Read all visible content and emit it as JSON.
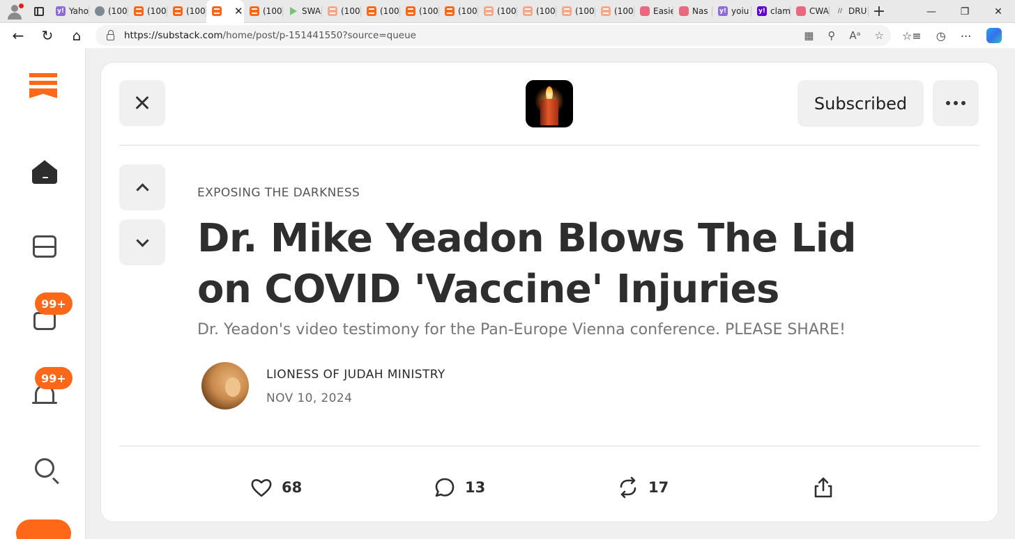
{
  "browser": {
    "tabs": [
      {
        "label": "Yaho",
        "favicon": "yahoo-icon",
        "type": "yahoo"
      },
      {
        "label": "(100",
        "favicon": "globe-icon",
        "type": "globe"
      },
      {
        "label": "(100",
        "favicon": "substack-icon",
        "type": "substack"
      },
      {
        "label": "(100",
        "favicon": "substack-icon",
        "type": "substack"
      },
      {
        "label": "",
        "favicon": "substack-icon",
        "type": "substack",
        "active": true
      },
      {
        "label": "(100",
        "favicon": "substack-icon",
        "type": "substack"
      },
      {
        "label": "SWA",
        "favicon": "play-icon",
        "type": "play"
      },
      {
        "label": "(100",
        "favicon": "substack-icon",
        "type": "substack-faded"
      },
      {
        "label": "(100",
        "favicon": "substack-icon",
        "type": "substack"
      },
      {
        "label": "(100",
        "favicon": "substack-icon",
        "type": "substack"
      },
      {
        "label": "(100",
        "favicon": "substack-icon",
        "type": "substack"
      },
      {
        "label": "(100",
        "favicon": "substack-icon",
        "type": "substack-faded"
      },
      {
        "label": "(100",
        "favicon": "substack-icon",
        "type": "substack-faded"
      },
      {
        "label": "(100",
        "favicon": "substack-icon",
        "type": "substack-faded"
      },
      {
        "label": "(100",
        "favicon": "substack-icon",
        "type": "substack-faded"
      },
      {
        "label": "Easie",
        "favicon": "youtube-icon",
        "type": "youtube"
      },
      {
        "label": "Nas",
        "favicon": "youtube-icon",
        "type": "youtube"
      },
      {
        "label": "yoiu",
        "favicon": "yahoo-icon",
        "type": "yahoo"
      },
      {
        "label": "clam",
        "favicon": "yahoo-icon",
        "type": "yahoo-dark"
      },
      {
        "label": "CWA",
        "favicon": "youtube-icon",
        "type": "youtube"
      },
      {
        "label": "DRU",
        "favicon": "dr-icon",
        "type": "dr"
      }
    ],
    "url_host": "https://substack.com",
    "url_path": "/home/post/p-151441550?source=queue"
  },
  "substack": {
    "rail": {
      "chat_badge": "99+",
      "notifications_badge": "99+"
    },
    "post": {
      "subscribe_label": "Subscribed",
      "section": "EXPOSING THE DARKNESS",
      "title": "Dr. Mike Yeadon Blows The Lid on COVID 'Vaccine' Injuries",
      "subtitle": "Dr. Yeadon's video testimony for the Pan-Europe Vienna conference. PLEASE SHARE!",
      "author": "LIONESS OF JUDAH MINISTRY",
      "date": "NOV 10, 2024",
      "likes": "68",
      "comments": "13",
      "restacks": "17"
    }
  },
  "colors": {
    "accent": "#ff6719",
    "text_dark": "#2e2e2e",
    "text_muted": "#767676"
  }
}
